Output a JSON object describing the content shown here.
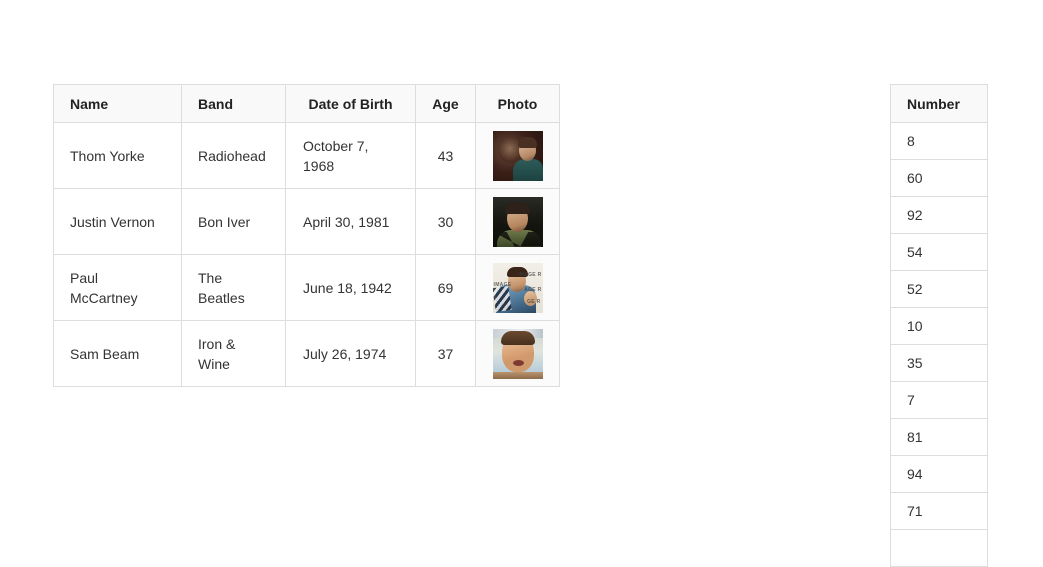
{
  "people_table": {
    "name": "musicians-table",
    "columns": [
      "Name",
      "Band",
      "Date of Birth",
      "Age",
      "Photo"
    ],
    "rows": [
      {
        "name": "Thom Yorke",
        "band": "Radiohead",
        "dob": "October 7, 1968",
        "age": "43",
        "photo_alt": "thom-yorke-photo"
      },
      {
        "name": "Justin Vernon",
        "band": "Bon Iver",
        "dob": "April 30, 1981",
        "age": "30",
        "photo_alt": "justin-vernon-photo"
      },
      {
        "name": "Paul McCartney",
        "band": "The Beatles",
        "dob": "June 18, 1942",
        "age": "69",
        "photo_alt": "paul-mccartney-photo"
      },
      {
        "name": "Sam Beam",
        "band": "Iron & Wine",
        "dob": "July 26, 1974",
        "age": "37",
        "photo_alt": "sam-beam-photo"
      }
    ]
  },
  "number_table": {
    "name": "number-table",
    "columns": [
      "Number"
    ],
    "values": [
      "8",
      "60",
      "92",
      "54",
      "52",
      "10",
      "35",
      "7",
      "81",
      "94",
      "71"
    ]
  },
  "photo3_watermark": {
    "w1": "IMAGE",
    "w2": "IMAGE R",
    "w3": "AGE R",
    "w4": "GE R"
  },
  "colors": {
    "page_background": "#ffffff",
    "border": "#dddddd",
    "header_background": "#f9f9f9",
    "header_text": "#222222",
    "body_text": "#333333",
    "photo_cell_background": "#fbfbfb"
  }
}
